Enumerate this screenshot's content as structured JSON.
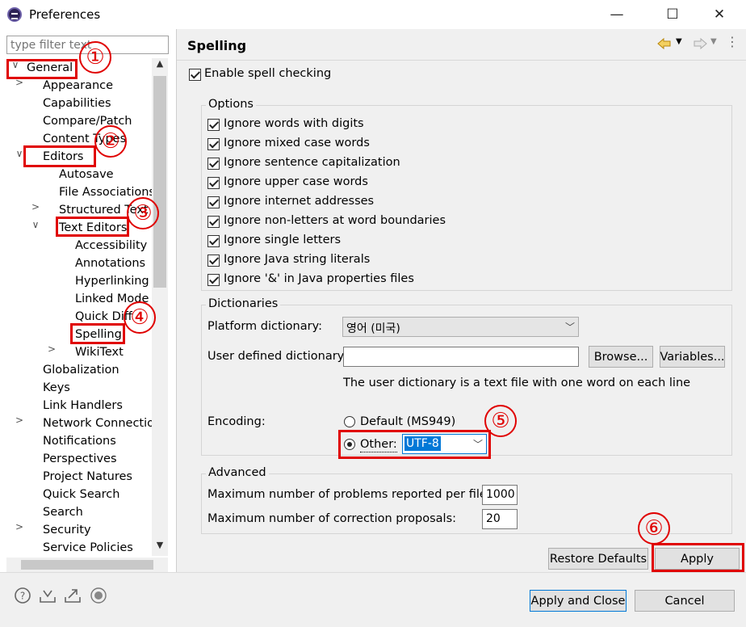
{
  "window": {
    "title": "Preferences",
    "minimize": "—",
    "maximize": "☐",
    "close": "✕"
  },
  "filter": {
    "placeholder": "type filter text"
  },
  "tree": [
    {
      "label": "General",
      "twisty": "∨"
    },
    {
      "label": "Appearance",
      "twisty": ">"
    },
    {
      "label": "Capabilities"
    },
    {
      "label": "Compare/Patch"
    },
    {
      "label": "Content Types"
    },
    {
      "label": "Editors",
      "twisty": "∨"
    },
    {
      "label": "Autosave"
    },
    {
      "label": "File Associations"
    },
    {
      "label": "Structured Text E",
      "twisty": ">"
    },
    {
      "label": "Text Editors",
      "twisty": "∨"
    },
    {
      "label": "Accessibility"
    },
    {
      "label": "Annotations"
    },
    {
      "label": "Hyperlinking"
    },
    {
      "label": "Linked Mode"
    },
    {
      "label": "Quick Diff"
    },
    {
      "label": "Spelling"
    },
    {
      "label": "WikiText",
      "twisty": ">"
    },
    {
      "label": "Globalization"
    },
    {
      "label": "Keys"
    },
    {
      "label": "Link Handlers"
    },
    {
      "label": "Network Connectio",
      "twisty": ">"
    },
    {
      "label": "Notifications"
    },
    {
      "label": "Perspectives"
    },
    {
      "label": "Project Natures"
    },
    {
      "label": "Quick Search"
    },
    {
      "label": "Search"
    },
    {
      "label": "Security",
      "twisty": ">"
    },
    {
      "label": "Service Policies"
    }
  ],
  "page": {
    "title": "Spelling"
  },
  "spelling": {
    "enable": "Enable spell checking",
    "options_title": "Options",
    "options": [
      "Ignore words with digits",
      "Ignore mixed case words",
      "Ignore sentence capitalization",
      "Ignore upper case words",
      "Ignore internet addresses",
      "Ignore non-letters at word boundaries",
      "Ignore single letters",
      "Ignore Java string literals",
      "Ignore '&' in Java properties files"
    ],
    "dictionaries_title": "Dictionaries",
    "platform_label": "Platform dictionary:",
    "platform_value": "영어 (미국)",
    "user_dict_label": "User defined dictionary:",
    "user_dict_value": "",
    "browse": "Browse...",
    "variables": "Variables...",
    "user_dict_hint": "The user dictionary is a text file with one word on each line",
    "encoding_label": "Encoding:",
    "default_encoding": "Default (MS949)",
    "other_label": "Other:",
    "other_value": "UTF-8",
    "advanced_title": "Advanced",
    "max_problems_label": "Maximum number of problems reported per file:",
    "max_problems_value": "1000",
    "max_proposals_label": "Maximum number of correction proposals:",
    "max_proposals_value": "20"
  },
  "buttons": {
    "restore": "Restore Defaults",
    "apply": "Apply",
    "apply_close": "Apply and Close",
    "cancel": "Cancel"
  },
  "annotations": [
    "①",
    "②",
    "③",
    "④",
    "⑤",
    "⑥"
  ],
  "colors": {
    "annotation": "#e00000",
    "selection": "#0078d7",
    "back_arrow": "#d4a010"
  }
}
